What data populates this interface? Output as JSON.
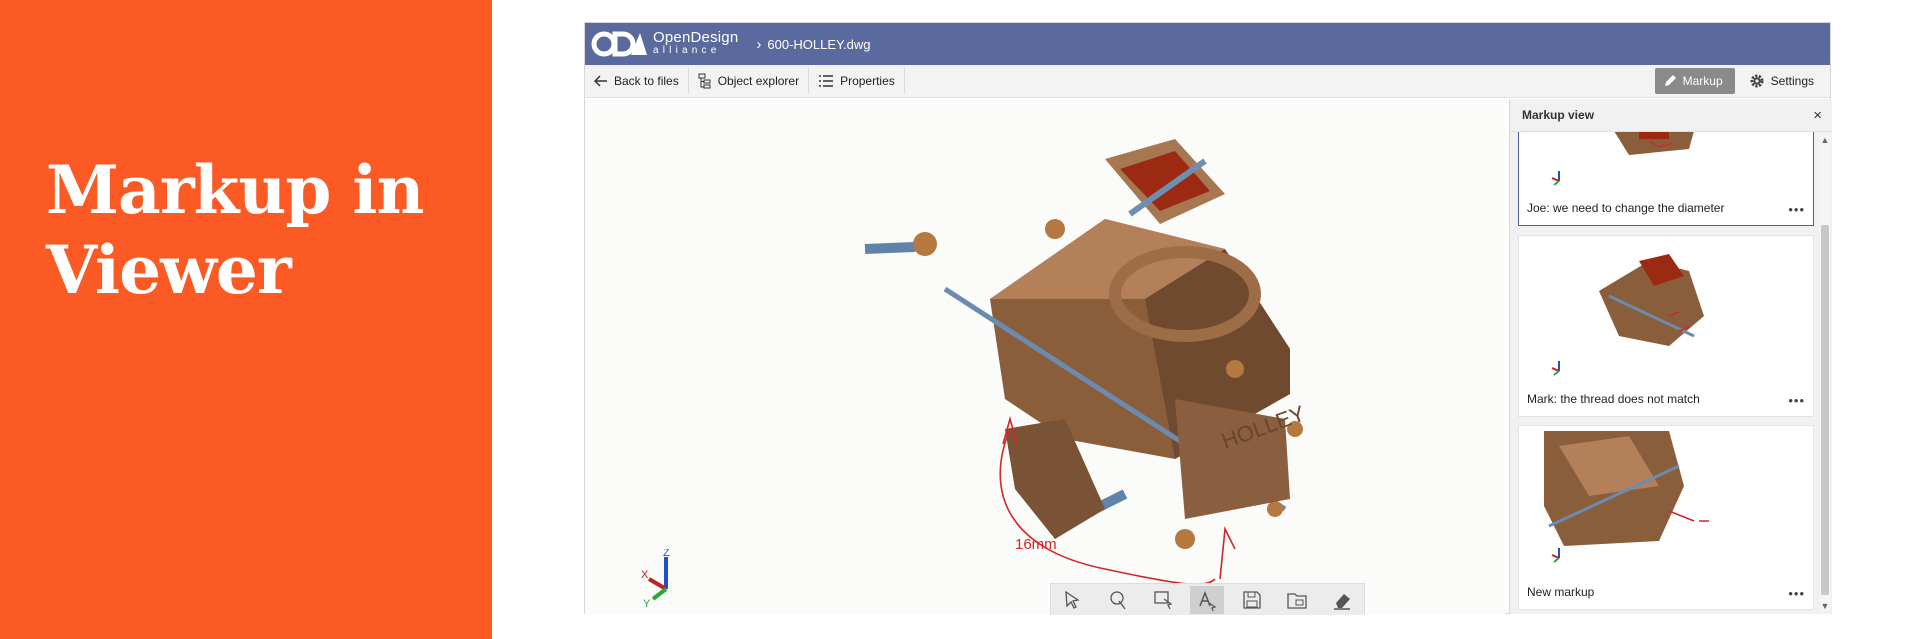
{
  "slide": {
    "title": "Markup in Viewer"
  },
  "app": {
    "brand_line1": "OpenDesign",
    "brand_line2": "alliance",
    "file_name": "600-HOLLEY.dwg"
  },
  "toolbar": {
    "back_label": "Back to files",
    "explorer_label": "Object explorer",
    "properties_label": "Properties",
    "markup_label": "Markup",
    "settings_label": "Settings"
  },
  "viewport": {
    "annotation_text": "16mm",
    "model_lettering": "HOLLEY",
    "axis_x": "X",
    "axis_y": "Y",
    "axis_z": "Z",
    "draw_tools": [
      "select-tool",
      "lasso-tool",
      "rectangle-select-tool",
      "text-tool",
      "save-tool",
      "folder-tool",
      "eraser-tool"
    ]
  },
  "panel": {
    "title": "Markup view",
    "close_glyph": "×",
    "more_glyph": "•••",
    "items": [
      {
        "label": "Joe: we need to change the diameter",
        "selected": true
      },
      {
        "label": "Mark: the thread does not match",
        "selected": false
      },
      {
        "label": "New markup",
        "selected": false
      }
    ]
  },
  "colors": {
    "slide_bg": "#fb5a25",
    "topbar_bg": "#5a6a9e",
    "markup_active": "#8a8a8a",
    "annotation_red": "#d0282a"
  }
}
